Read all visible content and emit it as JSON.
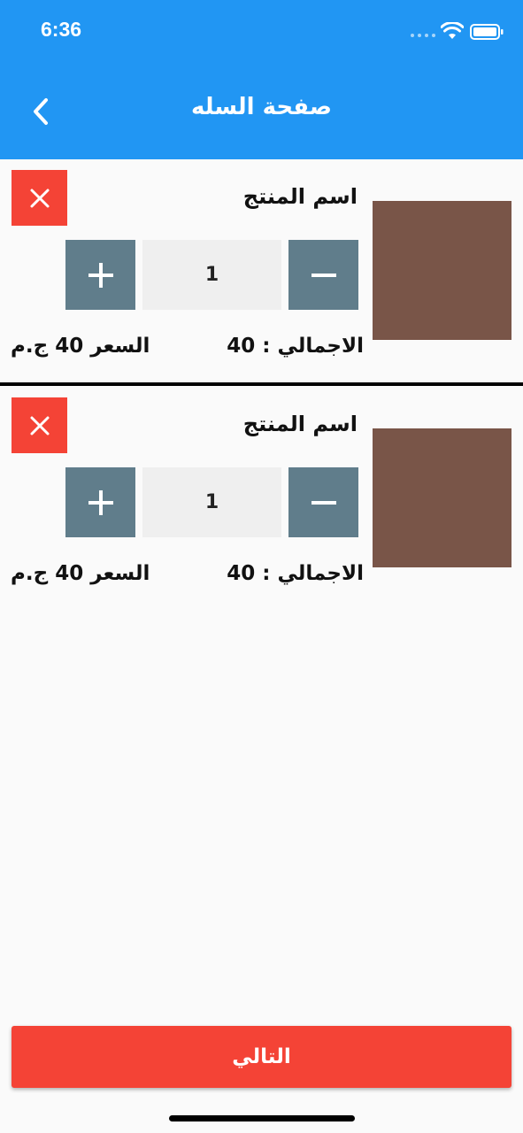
{
  "status_bar": {
    "time": "6:36"
  },
  "header": {
    "title": "صفحة السله",
    "back_icon": "chevron-left-icon",
    "color": "#2196f3"
  },
  "cart": {
    "items": [
      {
        "name": "اسم المنتج",
        "quantity": "1",
        "total": "الاجمالي : 40",
        "price": "السعر 40 ج.م"
      },
      {
        "name": "اسم المنتج",
        "quantity": "1",
        "total": "الاجمالي : 40",
        "price": "السعر 40 ج.م"
      }
    ]
  },
  "footer": {
    "next_label": "التالي"
  },
  "colors": {
    "accent": "#2196f3",
    "danger": "#f44336",
    "stepper": "#607d8b",
    "thumbnail": "#795548"
  }
}
